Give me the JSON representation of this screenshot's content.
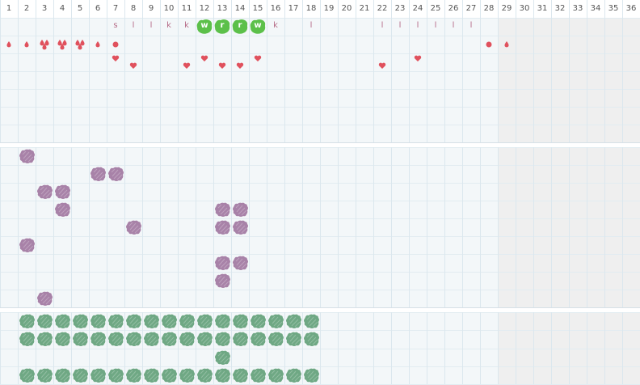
{
  "columns": [
    "1",
    "2",
    "3",
    "4",
    "5",
    "6",
    "7",
    "8",
    "9",
    "10",
    "11",
    "12",
    "13",
    "14",
    "15",
    "16",
    "17",
    "18",
    "19",
    "20",
    "21",
    "22",
    "23",
    "24",
    "25",
    "26",
    "27",
    "28",
    "29",
    "30",
    "31",
    "32",
    "33",
    "34",
    "35",
    "36"
  ],
  "colors": {
    "grid_line": "#dbe7ee",
    "grid_bg": "#f3f7f9",
    "inactive_bg": "#efefef",
    "letter": "#b56a86",
    "highlight": "#5cc04a",
    "drop": "#e0515d",
    "purple_blob": "#a882a8",
    "green_blob": "#6fa884"
  },
  "row1_letters": [
    {
      "col": 7,
      "text": "s"
    },
    {
      "col": 8,
      "text": "l"
    },
    {
      "col": 9,
      "text": "l"
    },
    {
      "col": 10,
      "text": "k"
    },
    {
      "col": 11,
      "text": "k"
    },
    {
      "col": 12,
      "text": "w",
      "hl": true
    },
    {
      "col": 13,
      "text": "r",
      "hl": true
    },
    {
      "col": 14,
      "text": "r",
      "hl": true
    },
    {
      "col": 15,
      "text": "w",
      "hl": true
    },
    {
      "col": 16,
      "text": "k"
    },
    {
      "col": 18,
      "text": "l"
    },
    {
      "col": 22,
      "text": "l"
    },
    {
      "col": 23,
      "text": "l"
    },
    {
      "col": 24,
      "text": "l"
    },
    {
      "col": 25,
      "text": "l"
    },
    {
      "col": 26,
      "text": "l"
    },
    {
      "col": 27,
      "text": "l"
    }
  ],
  "row2_glyphs": [
    {
      "col": 1,
      "icon": "drop-icon",
      "count": 1
    },
    {
      "col": 2,
      "icon": "drop-icon",
      "count": 1
    },
    {
      "col": 3,
      "icon": "drop-icon",
      "count": 3
    },
    {
      "col": 4,
      "icon": "drop-icon",
      "count": 3
    },
    {
      "col": 5,
      "icon": "drop-icon",
      "count": 3
    },
    {
      "col": 6,
      "icon": "drop-icon",
      "count": 1
    },
    {
      "col": 7,
      "icon": "dot-icon",
      "count": 1
    },
    {
      "col": 28,
      "icon": "dot-icon",
      "count": 1
    },
    {
      "col": 29,
      "icon": "drop-icon",
      "count": 1
    }
  ],
  "hearts": [
    {
      "col": 7,
      "row": 0
    },
    {
      "col": 8,
      "row": 1
    },
    {
      "col": 11,
      "row": 1
    },
    {
      "col": 12,
      "row": 0
    },
    {
      "col": 13,
      "row": 1
    },
    {
      "col": 14,
      "row": 1
    },
    {
      "col": 15,
      "row": 0
    },
    {
      "col": 22,
      "row": 1
    },
    {
      "col": 24,
      "row": 0
    }
  ],
  "purple_blobs": [
    {
      "col": 2,
      "row": 0
    },
    {
      "col": 6,
      "row": 1
    },
    {
      "col": 7,
      "row": 1
    },
    {
      "col": 3,
      "row": 2
    },
    {
      "col": 4,
      "row": 2
    },
    {
      "col": 4,
      "row": 3
    },
    {
      "col": 13,
      "row": 3
    },
    {
      "col": 14,
      "row": 3
    },
    {
      "col": 8,
      "row": 4
    },
    {
      "col": 13,
      "row": 4
    },
    {
      "col": 14,
      "row": 4
    },
    {
      "col": 2,
      "row": 5
    },
    {
      "col": 13,
      "row": 6
    },
    {
      "col": 14,
      "row": 6
    },
    {
      "col": 13,
      "row": 7
    },
    {
      "col": 3,
      "row": 8
    }
  ],
  "green_rows": [
    {
      "row": 0,
      "from": 2,
      "to": 18
    },
    {
      "row": 1,
      "from": 2,
      "to": 18
    },
    {
      "row": 2,
      "from": 13,
      "to": 13
    },
    {
      "row": 3,
      "from": 2,
      "to": 18
    }
  ]
}
